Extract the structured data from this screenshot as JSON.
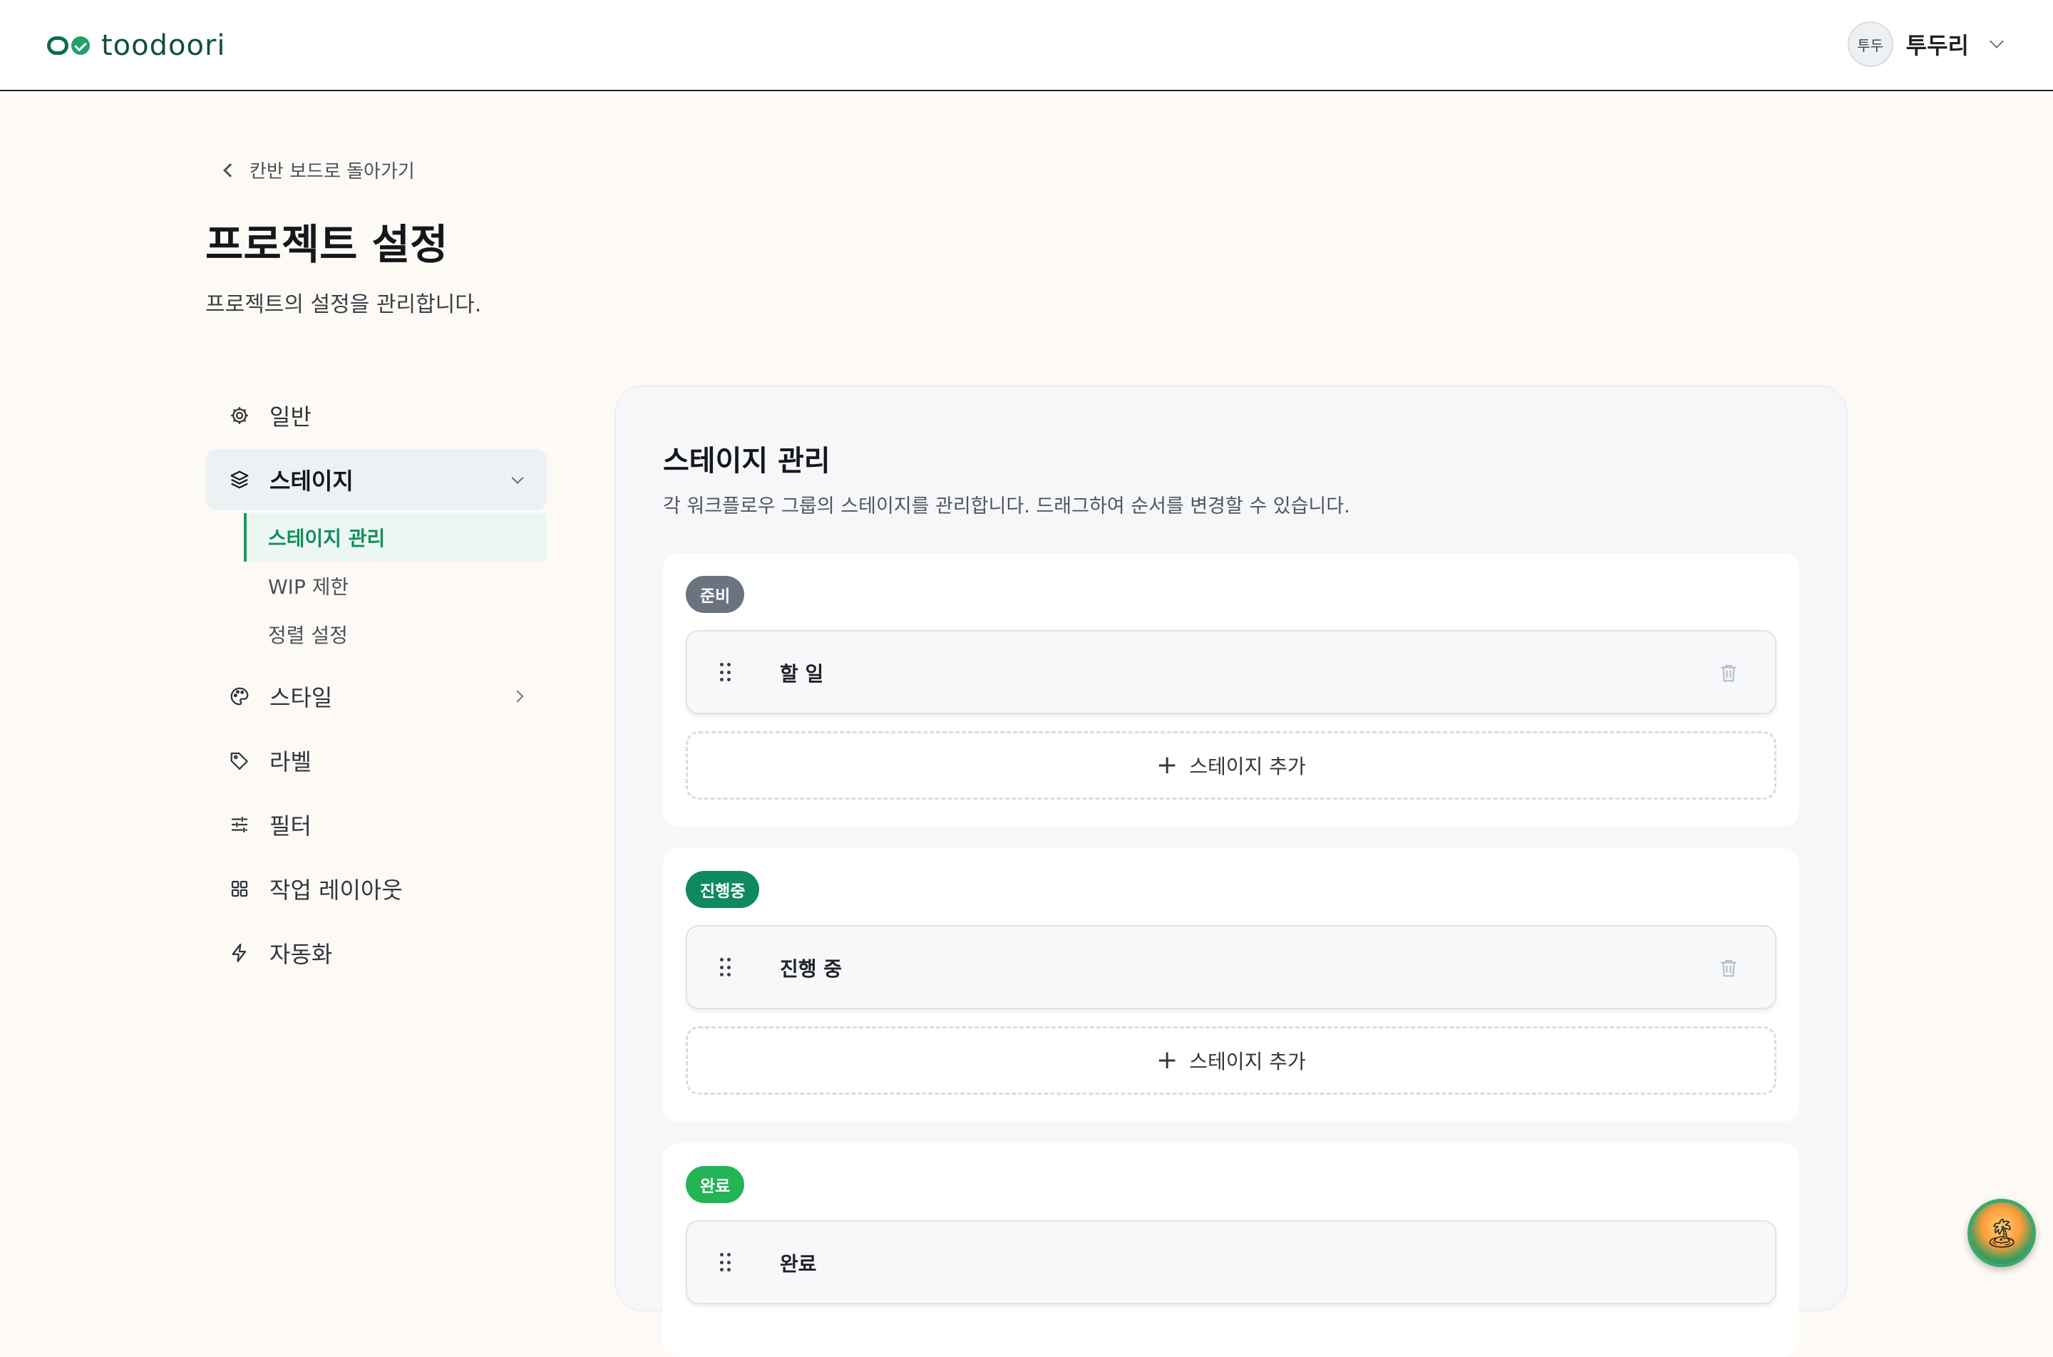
{
  "header": {
    "logo_text": "toodoori",
    "user": {
      "avatar_text": "투두",
      "name": "투두리"
    }
  },
  "back_link": {
    "label": "칸반 보드로 돌아가기"
  },
  "page": {
    "title": "프로젝트 설정",
    "subtitle": "프로젝트의 설정을 관리합니다."
  },
  "sidebar": {
    "items": [
      {
        "label": "일반",
        "icon": "gear-icon"
      },
      {
        "label": "스테이지",
        "icon": "layers-icon",
        "expanded": true,
        "children": [
          {
            "label": "스테이지 관리",
            "active": true
          },
          {
            "label": "WIP 제한"
          },
          {
            "label": "정렬 설정"
          }
        ]
      },
      {
        "label": "스타일",
        "icon": "palette-icon"
      },
      {
        "label": "라벨",
        "icon": "tag-icon"
      },
      {
        "label": "필터",
        "icon": "sliders-icon"
      },
      {
        "label": "작업 레이아웃",
        "icon": "grid-icon"
      },
      {
        "label": "자동화",
        "icon": "lightning-icon"
      }
    ]
  },
  "main": {
    "title": "스테이지 관리",
    "description": "각 워크플로우 그룹의 스테이지를 관리합니다. 드래그하여 순서를 변경할 수 있습니다.",
    "add_stage_label": "스테이지 추가",
    "groups": [
      {
        "badge": "준비",
        "badge_color": "#6b7280",
        "stages": [
          "할 일"
        ]
      },
      {
        "badge": "진행중",
        "badge_color": "#0f8a5f",
        "stages": [
          "진행 중"
        ]
      },
      {
        "badge": "완료",
        "badge_color": "#22b455",
        "stages": [
          "완료"
        ]
      }
    ]
  },
  "colors": {
    "accent": "#159c6a",
    "brand": "#0e4f43",
    "background": "#fdfaf6"
  }
}
